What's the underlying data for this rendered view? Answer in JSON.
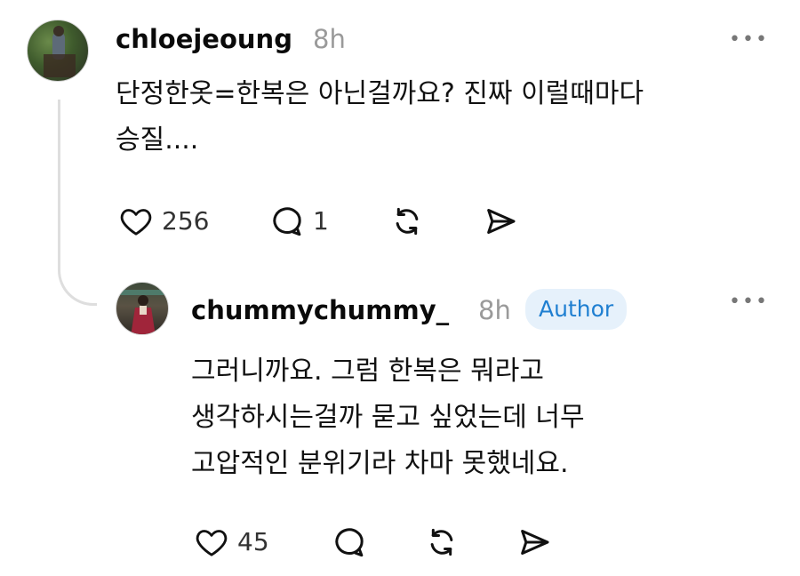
{
  "comment": {
    "username": "chloejeoung",
    "time": "8h",
    "text_lines": [
      "단정한옷=한복은 아닌걸까요? 진짜 이럴때마다",
      "승질...."
    ],
    "likes": "256",
    "replies": "1",
    "more_label": "•••"
  },
  "reply": {
    "username": "chummychummy_",
    "time": "8h",
    "badge": "Author",
    "text_lines": [
      "그러니까요. 그럼 한복은 뭐라고",
      "생각하시는걸까 묻고 싶었는데 너무",
      "고압적인 분위기라 차마 못했네요."
    ],
    "likes": "45",
    "more_label": "•••"
  },
  "colors": {
    "badge_bg": "#e6f1fb",
    "badge_text": "#1f7fd1",
    "muted": "#9a9a9a",
    "thread_line": "#dedede"
  },
  "icons": [
    "heart-icon",
    "comment-icon",
    "repost-icon",
    "share-icon",
    "more-icon"
  ]
}
